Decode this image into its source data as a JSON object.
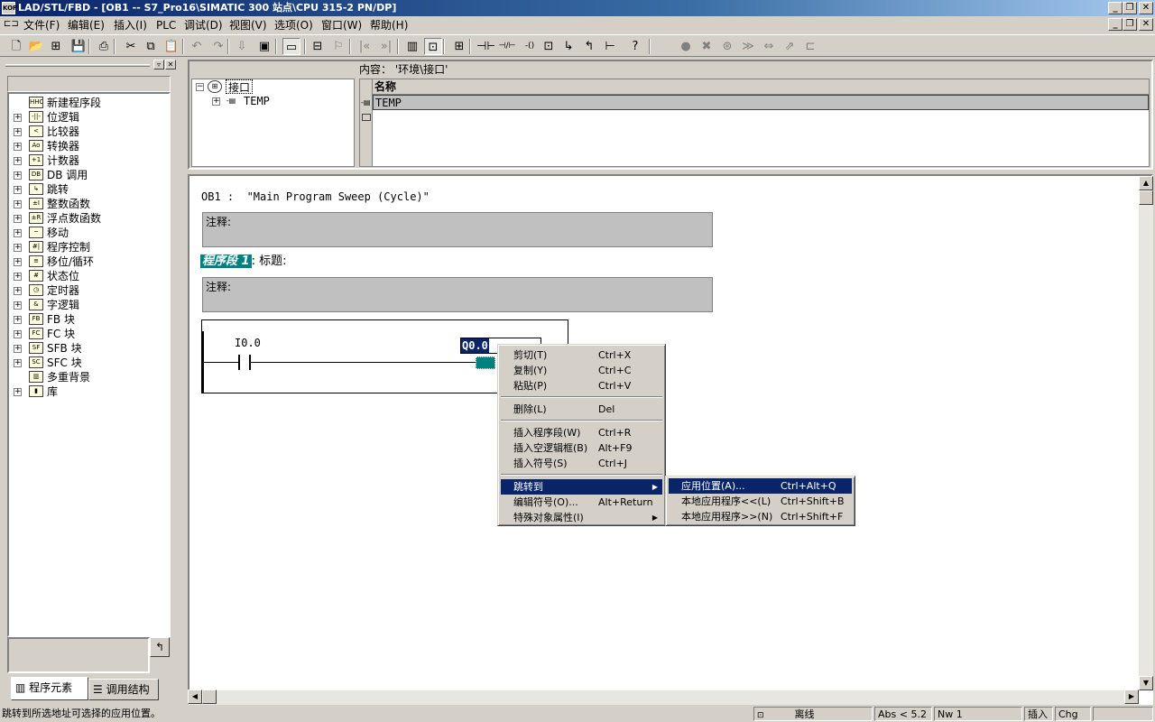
{
  "window": {
    "title": "LAD/STL/FBD  - [OB1 -- S7_Pro16\\SIMATIC 300 站点\\CPU 315-2 PN/DP]",
    "app_icon_text": "KOP"
  },
  "menubar": {
    "items": [
      "文件(F)",
      "编辑(E)",
      "插入(I)",
      "PLC",
      "调试(D)",
      "视图(V)",
      "选项(O)",
      "窗口(W)",
      "帮助(H)"
    ]
  },
  "toolbar": {
    "icons": [
      "new-icon",
      "open-icon",
      "accessible-nodes-icon",
      "save-icon",
      "print-icon",
      "cut-icon",
      "copy-icon",
      "paste-icon",
      "undo-icon",
      "redo-icon",
      "download-icon",
      "monitor-icon",
      "overview-icon",
      "reference-data-icon",
      "symbol-icon",
      "first-network-icon",
      "last-network-icon",
      "program-elements-icon",
      "details-view-icon",
      "insert-network-icon",
      "normally-open-contact-icon",
      "normally-closed-contact-icon",
      "coil-icon",
      "empty-box-icon",
      "open-branch-icon",
      "close-branch-icon",
      "connection-icon",
      "help-icon"
    ]
  },
  "catalog": {
    "items": [
      {
        "label": "新建程序段",
        "icon": "new-network-icon",
        "icon_text": "HHO",
        "expandable": false
      },
      {
        "label": "位逻辑",
        "icon": "bit-logic-icon",
        "icon_text": "-||-",
        "expandable": true
      },
      {
        "label": "比较器",
        "icon": "comparator-icon",
        "icon_text": "<",
        "expandable": true
      },
      {
        "label": "转换器",
        "icon": "converter-icon",
        "icon_text": "Ao",
        "expandable": true
      },
      {
        "label": "计数器",
        "icon": "counter-icon",
        "icon_text": "+1",
        "expandable": true
      },
      {
        "label": "DB 调用",
        "icon": "db-call-icon",
        "icon_text": "DB",
        "expandable": true
      },
      {
        "label": "跳转",
        "icon": "jump-icon",
        "icon_text": "↳",
        "expandable": true
      },
      {
        "label": "整数函数",
        "icon": "integer-function-icon",
        "icon_text": "±I",
        "expandable": true
      },
      {
        "label": "浮点数函数",
        "icon": "float-function-icon",
        "icon_text": "±R",
        "expandable": true
      },
      {
        "label": "移动",
        "icon": "move-icon",
        "icon_text": "~",
        "expandable": true
      },
      {
        "label": "程序控制",
        "icon": "program-control-icon",
        "icon_text": "#|",
        "expandable": true
      },
      {
        "label": "移位/循环",
        "icon": "shift-rotate-icon",
        "icon_text": "≡",
        "expandable": true
      },
      {
        "label": "状态位",
        "icon": "status-bits-icon",
        "icon_text": "#",
        "expandable": true
      },
      {
        "label": "定时器",
        "icon": "timer-icon",
        "icon_text": "◷",
        "expandable": true
      },
      {
        "label": "字逻辑",
        "icon": "word-logic-icon",
        "icon_text": "&",
        "expandable": true
      },
      {
        "label": "FB 块",
        "icon": "fb-block-icon",
        "icon_text": "FB",
        "expandable": true
      },
      {
        "label": "FC 块",
        "icon": "fc-block-icon",
        "icon_text": "FC",
        "expandable": true
      },
      {
        "label": "SFB 块",
        "icon": "sfb-block-icon",
        "icon_text": "SF",
        "expandable": true
      },
      {
        "label": "SFC 块",
        "icon": "sfc-block-icon",
        "icon_text": "SC",
        "expandable": true
      },
      {
        "label": "多重背景",
        "icon": "multiple-instance-icon",
        "icon_text": "▥",
        "expandable": false
      },
      {
        "label": "库",
        "icon": "library-icon",
        "icon_text": "▮",
        "expandable": true
      }
    ],
    "tabs": [
      "程序元素",
      "调用结构"
    ],
    "pin_icon_text": "↰"
  },
  "interface": {
    "content_label": "内容： '环境\\接口'",
    "tree_root": "接口",
    "tree_child": "TEMP",
    "column_name": "名称",
    "row_value": "TEMP"
  },
  "editor": {
    "block_header": "OB1 :  \"Main Program Sweep (Cycle)\"",
    "block_comment": "注释:",
    "network_label": "程序段 1",
    "network_title_suffix": ": 标题:",
    "network_comment": "注释:",
    "contact_address": "I0.0",
    "coil_address": "Q0.0"
  },
  "context_menu": {
    "items": [
      {
        "label": "剪切(T)",
        "accel": "Ctrl+X",
        "group": 0
      },
      {
        "label": "复制(Y)",
        "accel": "Ctrl+C",
        "group": 0
      },
      {
        "label": "粘贴(P)",
        "accel": "Ctrl+V",
        "group": 0
      },
      {
        "label": "删除(L)",
        "accel": "Del",
        "group": 1
      },
      {
        "label": "插入程序段(W)",
        "accel": "Ctrl+R",
        "group": 2
      },
      {
        "label": "插入空逻辑框(B)",
        "accel": "Alt+F9",
        "group": 2
      },
      {
        "label": "插入符号(S)",
        "accel": "Ctrl+J",
        "group": 2
      },
      {
        "label": "跳转到",
        "accel": "",
        "group": 3,
        "submenu": true,
        "selected": true
      },
      {
        "label": "编辑符号(O)...",
        "accel": "Alt+Return",
        "group": 3
      },
      {
        "label": "特殊对象属性(I)",
        "accel": "",
        "group": 3,
        "submenu": true
      }
    ]
  },
  "submenu": {
    "items": [
      {
        "label": "应用位置(A)...",
        "accel": "Ctrl+Alt+Q",
        "selected": true
      },
      {
        "label": "本地应用程序<<(L)",
        "accel": "Ctrl+Shift+B"
      },
      {
        "label": "本地应用程序>>(N)",
        "accel": "Ctrl+Shift+F"
      }
    ]
  },
  "statusbar": {
    "message": "跳转到所选地址可选择的应用位置。",
    "mode": "离线",
    "abs": "Abs < 5.2",
    "network": "Nw 1",
    "insert": "插入",
    "chg": "Chg"
  },
  "colors": {
    "title_active": "#0a246a",
    "selection": "#0a246a",
    "network_highlight": "#008080",
    "face": "#d4d0c8"
  }
}
